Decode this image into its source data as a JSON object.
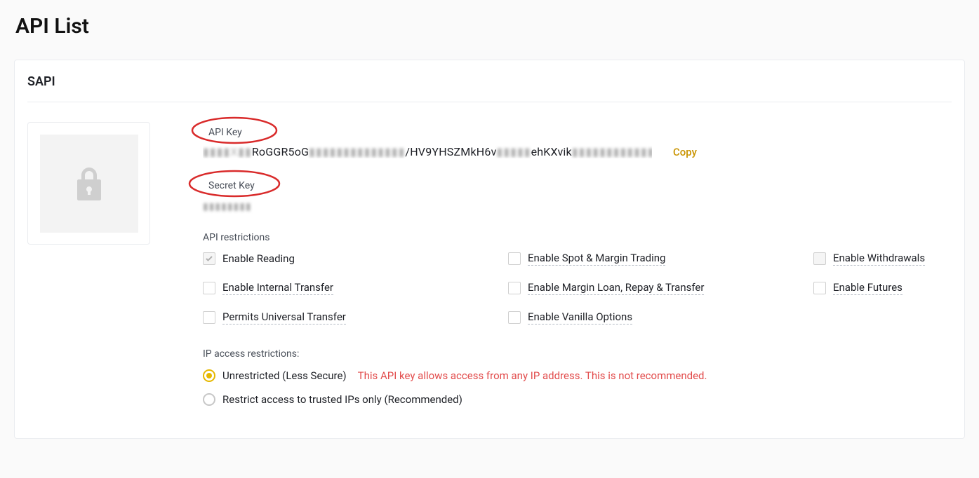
{
  "pageTitle": "API List",
  "apiName": "SAPI",
  "apiKey": {
    "label": "API Key",
    "pre1": "▮▮▮▮X▮▮",
    "clear1": "RoGGR5oG",
    "mid1": "▮▮▮▮▮▮▮▮▮▮▮▮▮▮",
    "clear2": "/HV9YHSZMkH6v",
    "mid2": "▮▮▮▮▮",
    "clear3": "ehKXvik",
    "tail": "▮▮▮▮▮▮▮▮▮▮▮▮▮▮v",
    "copyLabel": "Copy"
  },
  "secretKey": {
    "label": "Secret Key",
    "valueMasked": "▮▮▮▮▮▮▮▮"
  },
  "restrictions": {
    "label": "API restrictions",
    "items": {
      "reading": "Enable Reading",
      "spotMargin": "Enable Spot & Margin Trading",
      "withdrawals": "Enable Withdrawals",
      "internalTransfer": "Enable Internal Transfer",
      "marginLoan": "Enable Margin Loan, Repay & Transfer",
      "futures": "Enable Futures",
      "universalTransfer": "Permits Universal Transfer",
      "vanillaOptions": "Enable Vanilla Options"
    }
  },
  "ipAccess": {
    "label": "IP access restrictions:",
    "unrestricted": "Unrestricted (Less Secure)",
    "warning": "This API key allows access from any IP address. This is not recommended.",
    "restricted": "Restrict access to trusted IPs only (Recommended)"
  },
  "annotations": {
    "ellipseColor": "#d92b2b"
  }
}
